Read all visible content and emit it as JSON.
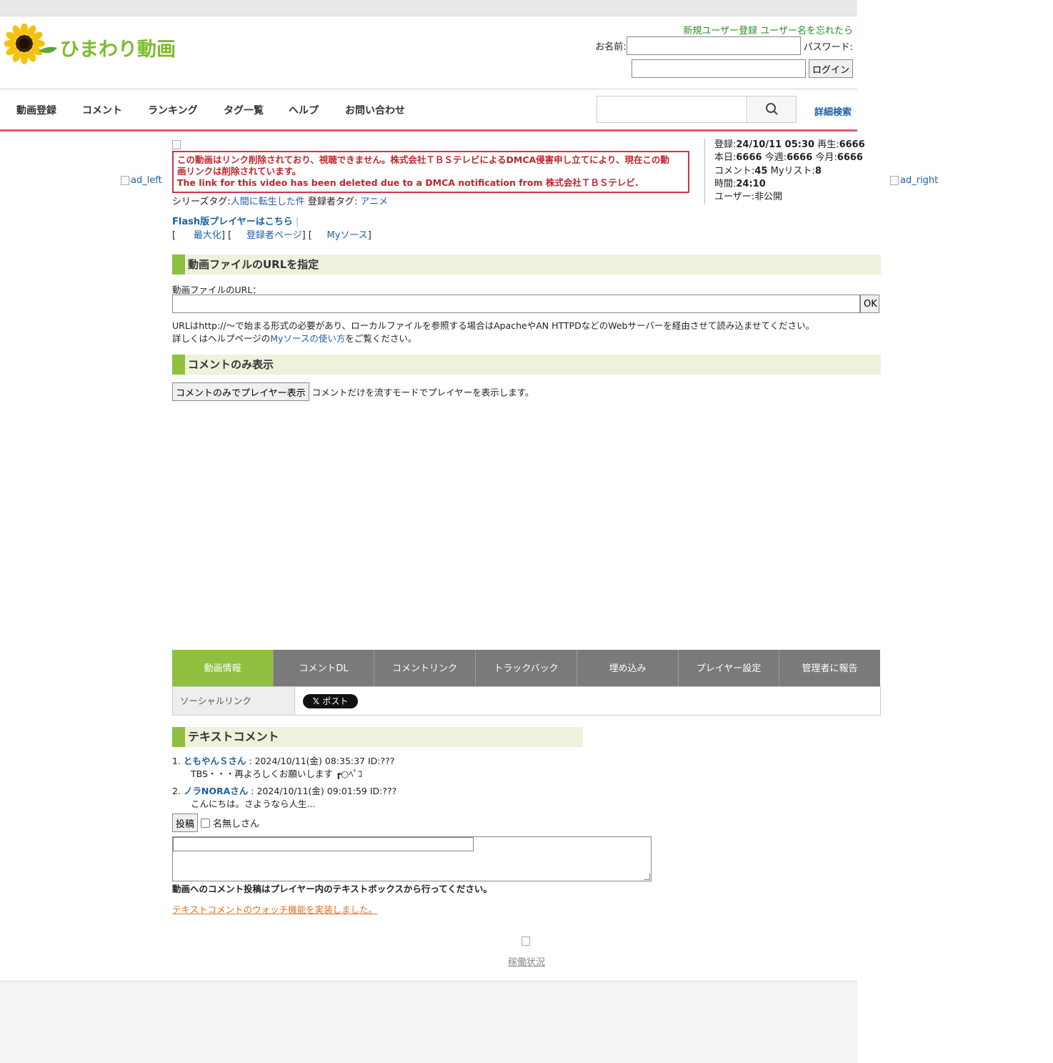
{
  "header": {
    "logo_text": "ひまわり動画",
    "register_link": "新規ユーザー登録",
    "forgot_link": "ユーザー名を忘れたら",
    "name_label": "お名前:",
    "password_label": "パスワード:",
    "login_button": "ログイン"
  },
  "nav": {
    "items": [
      "動画登録",
      "コメント",
      "ランキング",
      "タグ一覧",
      "ヘルプ",
      "お問い合わせ"
    ],
    "advanced_search": "詳細検索"
  },
  "ads": {
    "left": "ad_left",
    "right": "ad_right"
  },
  "notice": {
    "line1": "この動画はリンク削除されており、視聴できません。株式会社ＴＢＳテレビによるDMCA侵害申し立てにより、現在この動",
    "line2": "画リンクは削除されています。",
    "line3": "The link for this video has been deleted due to a DMCA notification from 株式会社ＴＢＳテレビ."
  },
  "tags": {
    "series_label": "シリーズタグ:",
    "series_value": "人間に転生した件",
    "owner_label": " 登録者タグ: ",
    "owner_value": "アニメ"
  },
  "stats": {
    "registered_label": "登録:",
    "registered": "24/10/11 05:30",
    "plays_label": " 再生:",
    "plays": "6666",
    "today_label": "本日:",
    "today": "6666",
    "week_label": " 今週:",
    "week": "6666",
    "month_label": " 今月:",
    "month": "6666",
    "comments_label": "コメント:",
    "comments": "45",
    "mylist_label": " Myリスト:",
    "mylist": "8",
    "duration_label": "時間:",
    "duration": "24:10",
    "user_label": "ユーザー:",
    "user": "非公開"
  },
  "links": {
    "flash": "Flash版プレイヤーはこちら",
    "sep": " |",
    "maximize": "最大化",
    "owner_page": "登録者ページ",
    "mysource": "Myソース"
  },
  "url_section": {
    "title": "動画ファイルのURLを指定",
    "field_label": "動画ファイルのURL：",
    "ok": "OK",
    "desc1": "URLはhttp://〜で始まる形式の必要があり、ローカルファイルを参照する場合はApacheやAN HTTPDなどのWebサーバーを経由させて読み込ませてください。",
    "desc2_pre": "詳しくはヘルプページの",
    "desc2_link": "Myソースの使い方",
    "desc2_post": "をご覧ください。"
  },
  "comment_only": {
    "title": "コメントのみ表示",
    "button": "コメントのみでプレイヤー表示",
    "desc": " コメントだけを流すモードでプレイヤーを表示します。"
  },
  "tabs": [
    "動画情報",
    "コメントDL",
    "コメントリンク",
    "トラックバック",
    "埋め込み",
    "プレイヤー設定",
    "管理者に報告"
  ],
  "social": {
    "label": "ソーシャルリンク",
    "post_button": "ポスト"
  },
  "text_comments": {
    "title": "テキストコメント",
    "items": [
      {
        "num": "1.",
        "name": "ともやんＳさん",
        "meta": " : 2024/10/11(金) 08:35:37 ID:???",
        "body": "TBS・・・再よろしくお願いします ┏○ﾍﾟｺ"
      },
      {
        "num": "2.",
        "name": "ノラNORAさん",
        "meta": " : 2024/10/11(金) 09:01:59 ID:???",
        "body": "こんにちは。さようなら人生..."
      }
    ],
    "post_button": "投稿",
    "anon_label": "名無しさん",
    "note": "動画へのコメント投稿はプレイヤー内のテキストボックスから行ってください。",
    "watch_link": "テキストコメントのウォッチ機能を実装しました。"
  },
  "footer": {
    "status_link": "稼働状況"
  },
  "colors": {
    "accent_green": "#8fc03f",
    "nav_red": "#e25a6a",
    "link_blue": "#1f5fa8",
    "notice_red": "#c0262b"
  }
}
